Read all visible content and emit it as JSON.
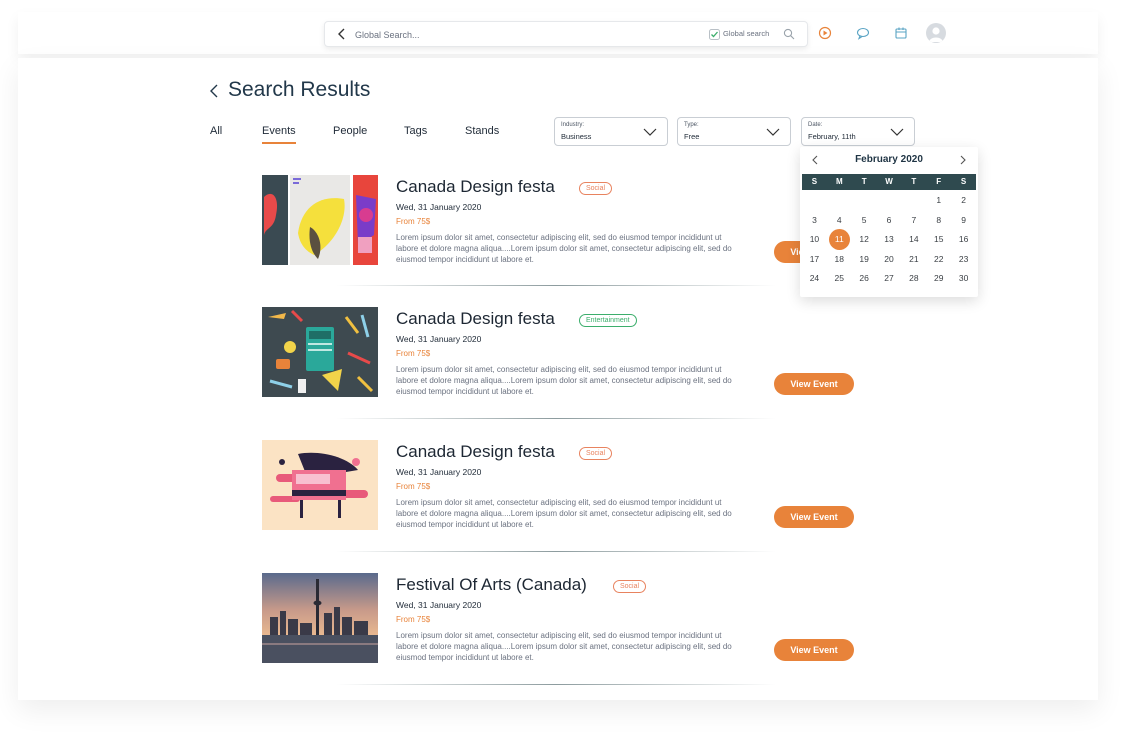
{
  "search": {
    "placeholder": "Global Search...",
    "global_label": "Global search"
  },
  "header": {
    "icons": [
      "play-icon",
      "chat-icon",
      "calendar-icon",
      "user-avatar"
    ]
  },
  "page": {
    "title": "Search Results"
  },
  "tabs": [
    {
      "label": "All",
      "active": false
    },
    {
      "label": "Events",
      "active": true
    },
    {
      "label": "People",
      "active": false
    },
    {
      "label": "Tags",
      "active": false
    },
    {
      "label": "Stands",
      "active": false
    }
  ],
  "filters": [
    {
      "label": "Industry:",
      "value": "Business"
    },
    {
      "label": "Type:",
      "value": "Free"
    },
    {
      "label": "Date:",
      "value": "February, 11th"
    }
  ],
  "calendar": {
    "month": "February 2020",
    "weekdays": [
      "S",
      "M",
      "T",
      "W",
      "T",
      "F",
      "S"
    ],
    "weeks": [
      [
        "",
        "",
        "",
        "",
        "",
        "1",
        "2"
      ],
      [
        "3",
        "4",
        "5",
        "6",
        "7",
        "8",
        "9"
      ],
      [
        "10",
        "11",
        "12",
        "13",
        "14",
        "15",
        "16"
      ],
      [
        "17",
        "18",
        "19",
        "20",
        "21",
        "22",
        "23"
      ],
      [
        "24",
        "25",
        "26",
        "27",
        "28",
        "29",
        "30"
      ]
    ],
    "selected": "11"
  },
  "events": [
    {
      "title": "Canada Design festa",
      "tag": "Social",
      "date": "Wed, 31 January 2020",
      "price": "From 75$",
      "description": "Lorem ipsum dolor sit amet, consectetur adipiscing elit, sed do eiusmod tempor incididunt ut labore et dolore magna aliqua....Lorem ipsum dolor sit amet, consectetur adipiscing elit, sed do eiusmod tempor incididunt ut labore et.",
      "button": "View Event"
    },
    {
      "title": "Canada Design festa",
      "tag": "Entertainment",
      "date": "Wed, 31 January 2020",
      "price": "From 75$",
      "description": "Lorem ipsum dolor sit amet, consectetur adipiscing elit, sed do eiusmod tempor incididunt ut labore et dolore magna aliqua....Lorem ipsum dolor sit amet, consectetur adipiscing elit, sed do eiusmod tempor incididunt ut labore et.",
      "button": "View Event"
    },
    {
      "title": "Canada Design festa",
      "tag": "Social",
      "date": "Wed, 31 January 2020",
      "price": "From 75$",
      "description": "Lorem ipsum dolor sit amet, consectetur adipiscing elit, sed do eiusmod tempor incididunt ut labore et dolore magna aliqua....Lorem ipsum dolor sit amet, consectetur adipiscing elit, sed do eiusmod tempor incididunt ut labore et.",
      "button": "View Event"
    },
    {
      "title": "Festival Of Arts (Canada)",
      "tag": "Social",
      "date": "Wed, 31 January 2020",
      "price": "From 75$",
      "description": "Lorem ipsum dolor sit amet, consectetur adipiscing elit, sed do eiusmod tempor incididunt ut labore et dolore magna aliqua....Lorem ipsum dolor sit amet, consectetur adipiscing elit, sed do eiusmod tempor incididunt ut labore et.",
      "button": "View Event"
    }
  ],
  "colors": {
    "accent": "#e8833a",
    "dark_teal": "#2f4a4f",
    "social_tag": "#e8835f",
    "entertainment_tag": "#3cae6c"
  }
}
